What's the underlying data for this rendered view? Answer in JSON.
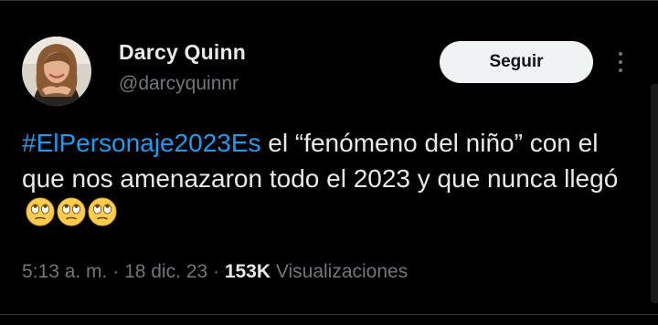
{
  "colors": {
    "background": "#000000",
    "text_primary": "#e7e9ea",
    "text_secondary": "#71767b",
    "hashtag": "#1d9bf0",
    "follow_button_bg": "#eff3f4",
    "divider": "#2f3336"
  },
  "author": {
    "display_name": "Darcy Quinn",
    "handle": "@darcyquinnr",
    "avatar_icon": "avatar-photo"
  },
  "actions": {
    "follow_label": "Seguir",
    "more_icon": "more-vertical-icon"
  },
  "tweet": {
    "hashtag": "#ElPersonaje2023Es",
    "body": " el “fenómeno del niño” con el que nos amenazaron todo el 2023 y que nunca llegó",
    "emojis": [
      "face-with-rolling-eyes",
      "face-with-rolling-eyes",
      "face-with-rolling-eyes"
    ]
  },
  "meta": {
    "time": "5:13 a. m.",
    "separator": " · ",
    "date": "18 dic. 23",
    "views_count": "153K",
    "views_label": "Visualizaciones"
  }
}
